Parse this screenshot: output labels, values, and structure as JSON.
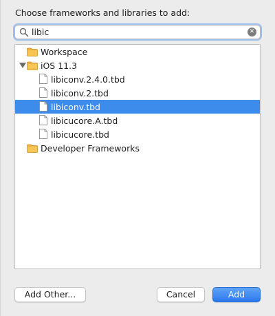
{
  "dialog": {
    "title": "Choose frameworks and libraries to add:"
  },
  "search": {
    "value": "libic",
    "icon": "search-icon",
    "clear_icon": "clear-icon",
    "clear_glyph": "✕"
  },
  "tree": {
    "items": [
      {
        "label": "Workspace",
        "icon": "folder-icon",
        "expanded": false,
        "selected": false
      },
      {
        "label": "iOS 11.3",
        "icon": "folder-icon",
        "expanded": true,
        "selected": false
      },
      {
        "label": "libiconv.2.4.0.tbd",
        "icon": "file-icon",
        "selected": false
      },
      {
        "label": "libiconv.2.tbd",
        "icon": "file-icon",
        "selected": false
      },
      {
        "label": "libiconv.tbd",
        "icon": "file-icon",
        "selected": true
      },
      {
        "label": "libicucore.A.tbd",
        "icon": "file-icon",
        "selected": false
      },
      {
        "label": "libicucore.tbd",
        "icon": "file-icon",
        "selected": false
      },
      {
        "label": "Developer Frameworks",
        "icon": "folder-icon",
        "expanded": false,
        "selected": false
      }
    ]
  },
  "buttons": {
    "add_other": "Add Other...",
    "cancel": "Cancel",
    "add": "Add"
  },
  "colors": {
    "selection": "#3d8bea",
    "folder": "#f0b33b",
    "primary_button": "#2c79ee"
  }
}
